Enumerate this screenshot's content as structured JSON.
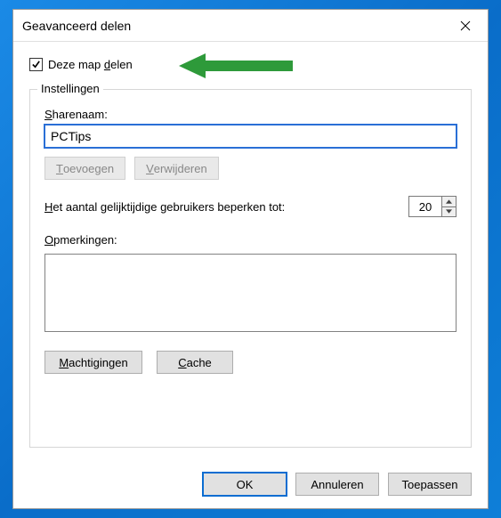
{
  "window": {
    "title": "Geavanceerd delen"
  },
  "share": {
    "checkbox_label_pre": "Deze map ",
    "checkbox_label_u": "d",
    "checkbox_label_post": "elen",
    "checked": true
  },
  "group": {
    "legend": "Instellingen",
    "sharename_label_u": "S",
    "sharename_label_post": "harenaam:",
    "sharename_value": "PCTips",
    "add_u": "T",
    "add_post": "oevoegen",
    "remove_u": "V",
    "remove_post": "erwijderen",
    "limit_pre": "H",
    "limit_post": "et aantal gelijktijdige gebruikers beperken tot:",
    "limit_value": "20",
    "comments_u": "O",
    "comments_post": "pmerkingen:",
    "comments_value": "",
    "perm_u": "M",
    "perm_post": "achtigingen",
    "cache_u": "C",
    "cache_post": "ache"
  },
  "buttons": {
    "ok": "OK",
    "cancel": "Annuleren",
    "apply": "Toepassen"
  }
}
